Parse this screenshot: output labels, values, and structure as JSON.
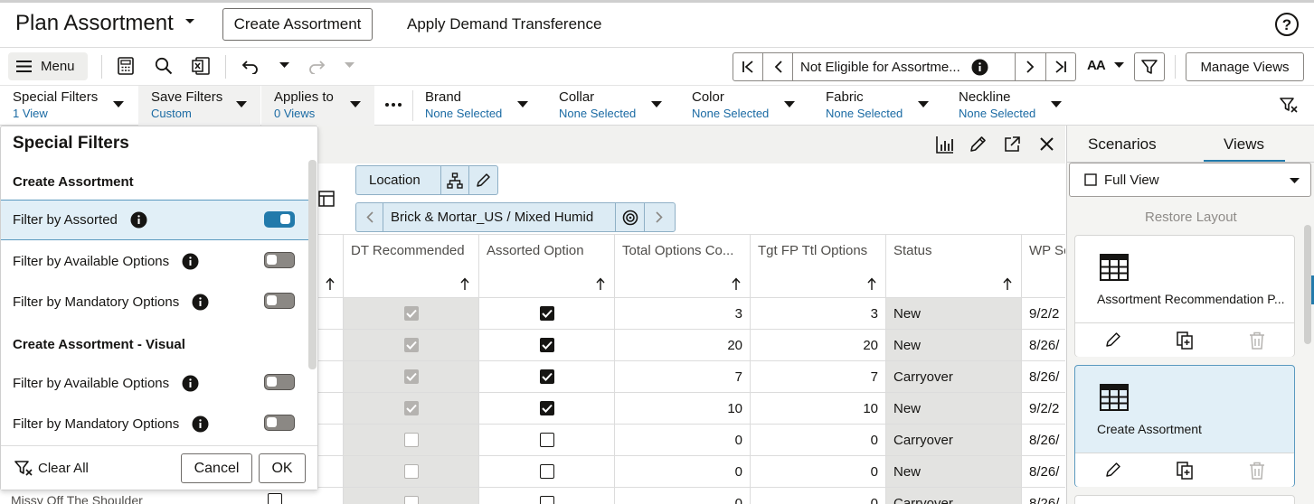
{
  "header": {
    "title": "Plan Assortment",
    "create_assortment": "Create Assortment",
    "apply_demand": "Apply Demand Transference"
  },
  "toolbar": {
    "menu_label": "Menu",
    "nav_text": "Not Eligible for Assortme...",
    "manage_views": "Manage Views",
    "font_size_label": "AA"
  },
  "filterbar": {
    "special_filters": {
      "label": "Special Filters",
      "value": "1 View"
    },
    "save_filters": {
      "label": "Save Filters",
      "value": "Custom"
    },
    "applies_to": {
      "label": "Applies to",
      "value": "0 Views"
    },
    "brand": {
      "label": "Brand",
      "value": "None Selected"
    },
    "collar": {
      "label": "Collar",
      "value": "None Selected"
    },
    "color": {
      "label": "Color",
      "value": "None Selected"
    },
    "fabric": {
      "label": "Fabric",
      "value": "None Selected"
    },
    "neckline": {
      "label": "Neckline",
      "value": "None Selected"
    }
  },
  "location": {
    "label": "Location",
    "path": "Brick & Mortar_US / Mixed Humid"
  },
  "table": {
    "columns": [
      "DT Recommended",
      "Assorted Option",
      "Total Options Co...",
      "Tgt FP Ttl Options",
      "Status",
      "WP Se"
    ],
    "rows": [
      {
        "dt": true,
        "assorted": true,
        "total": "3",
        "tgt": "3",
        "status": "New",
        "wp": "9/2/2"
      },
      {
        "dt": true,
        "assorted": true,
        "total": "20",
        "tgt": "20",
        "status": "New",
        "wp": "8/26/"
      },
      {
        "dt": true,
        "assorted": true,
        "total": "7",
        "tgt": "7",
        "status": "Carryover",
        "wp": "8/26/"
      },
      {
        "dt": true,
        "assorted": true,
        "total": "10",
        "tgt": "10",
        "status": "New",
        "wp": "9/2/2"
      },
      {
        "dt": false,
        "assorted": false,
        "total": "0",
        "tgt": "0",
        "status": "Carryover",
        "wp": "8/26/"
      },
      {
        "dt": false,
        "assorted": false,
        "total": "0",
        "tgt": "0",
        "status": "New",
        "wp": "8/26/"
      },
      {
        "dt": false,
        "assorted": false,
        "total": "0",
        "tgt": "0",
        "status": "Carryover",
        "wp": "8/26/"
      }
    ],
    "partial_row_label": "Missy Off The Shoulder"
  },
  "special_filters_popup": {
    "title": "Special Filters",
    "group1": "Create Assortment",
    "group2": "Create Assortment - Visual",
    "rows": [
      {
        "label": "Filter by Assorted",
        "on": true
      },
      {
        "label": "Filter by Available Options",
        "on": false
      },
      {
        "label": "Filter by Mandatory Options",
        "on": false
      },
      {
        "label": "Filter by Available Options",
        "on": false
      },
      {
        "label": "Filter by Mandatory Options",
        "on": false
      }
    ],
    "clear_all": "Clear All",
    "cancel": "Cancel",
    "ok": "OK"
  },
  "right_panel": {
    "tabs": [
      "Scenarios",
      "Views"
    ],
    "active_tab": "Views",
    "view_select": "Full View",
    "restore_layout": "Restore Layout",
    "cards": [
      {
        "name": "Assortment Recommendation P...",
        "selected": false
      },
      {
        "name": "Create Assortment",
        "selected": true
      }
    ]
  },
  "colors": {
    "accent": "#227aab",
    "selected_bg": "#e1eff7",
    "link": "#1a6aa3"
  }
}
